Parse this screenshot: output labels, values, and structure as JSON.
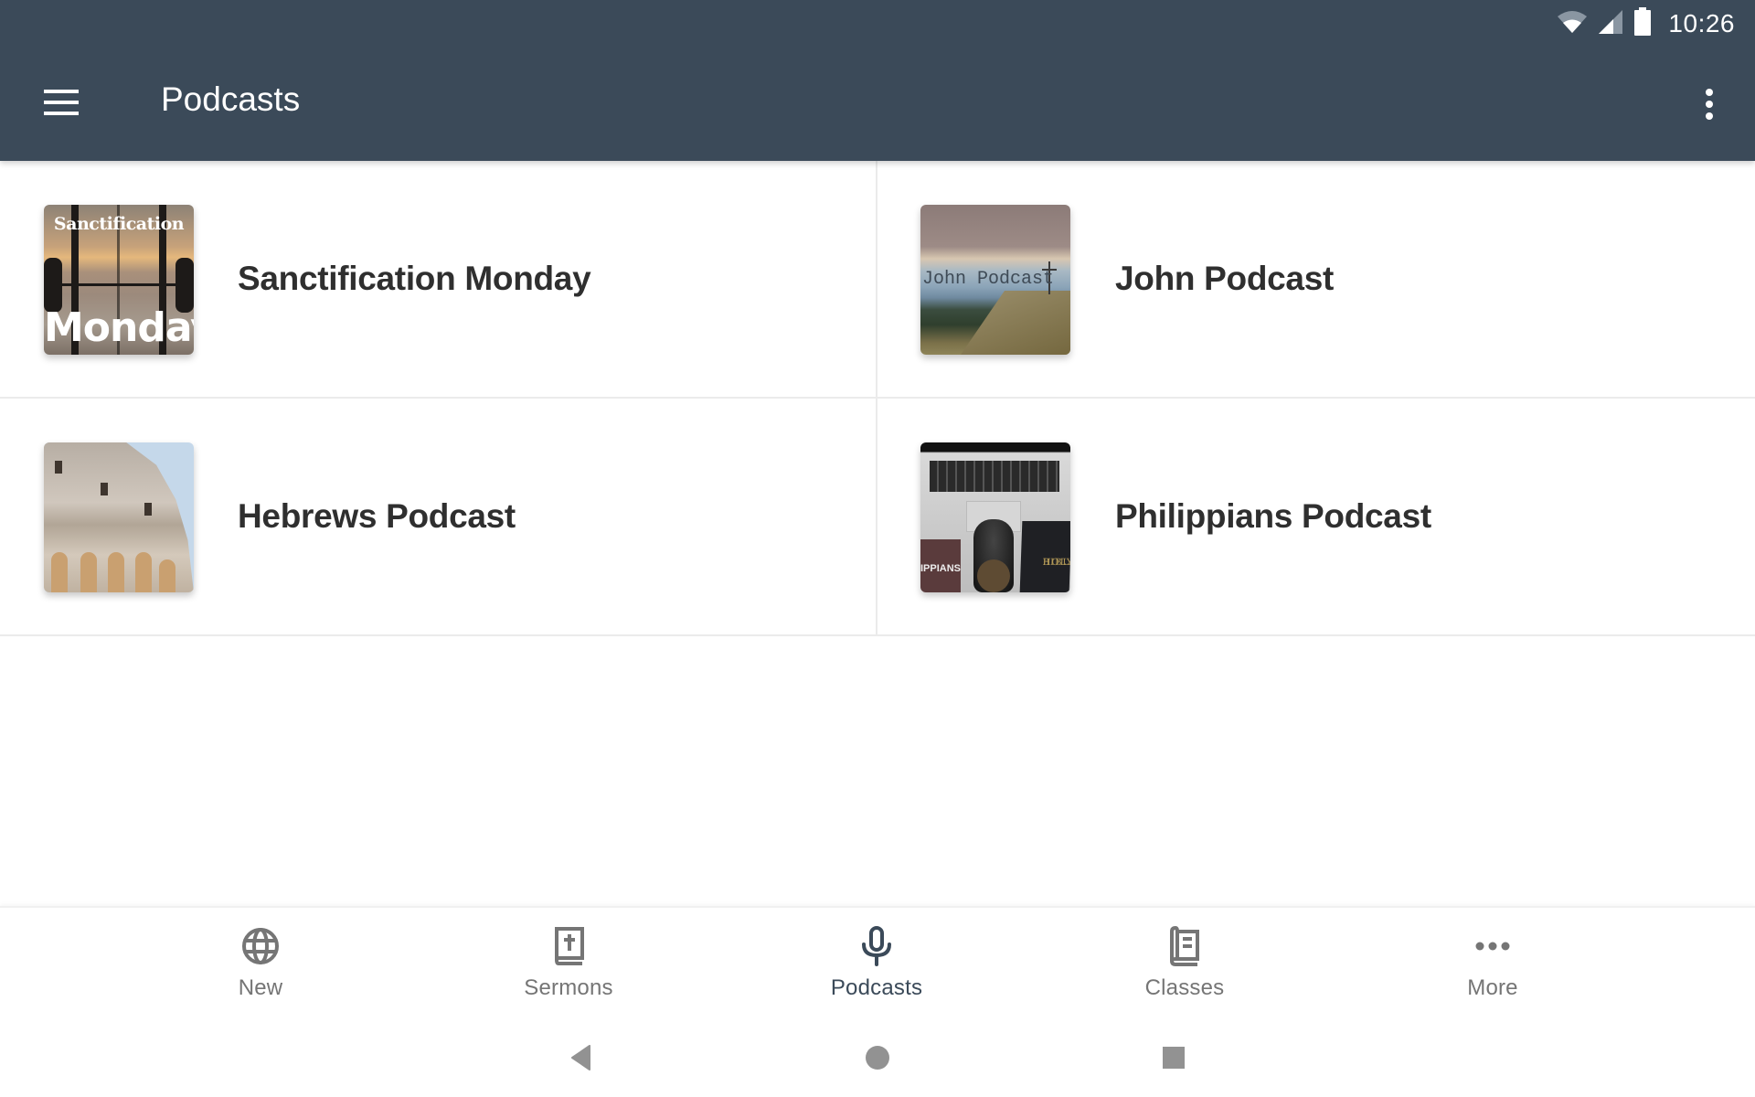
{
  "status_bar": {
    "time": "10:26",
    "icons": [
      "wifi-icon",
      "cell-signal-icon",
      "battery-icon"
    ]
  },
  "app_bar": {
    "menu_icon": "hamburger-menu-icon",
    "title": "Podcasts",
    "overflow_icon": "more-vert-icon",
    "background_color": "#3b4a59"
  },
  "podcasts": [
    {
      "title": "Sanctification Monday",
      "thumbnail_text": [
        "Sanctification",
        "Monday"
      ]
    },
    {
      "title": "John Podcast",
      "thumbnail_text": [
        "John Podcast"
      ]
    },
    {
      "title": "Hebrews Podcast",
      "thumbnail_text": []
    },
    {
      "title": "Philippians Podcast",
      "thumbnail_text": [
        "IPPIANS",
        "HOLY",
        "BIBLE"
      ]
    }
  ],
  "bottom_nav": {
    "items": [
      {
        "label": "New",
        "icon": "globe-icon",
        "active": false
      },
      {
        "label": "Sermons",
        "icon": "bible-cross-icon",
        "active": false
      },
      {
        "label": "Podcasts",
        "icon": "microphone-icon",
        "active": true
      },
      {
        "label": "Classes",
        "icon": "book-icon",
        "active": false
      },
      {
        "label": "More",
        "icon": "more-horiz-icon",
        "active": false
      }
    ],
    "active_color": "#3b4a59",
    "inactive_color": "#757575"
  },
  "system_nav": {
    "buttons": [
      "back",
      "home",
      "recents"
    ]
  }
}
